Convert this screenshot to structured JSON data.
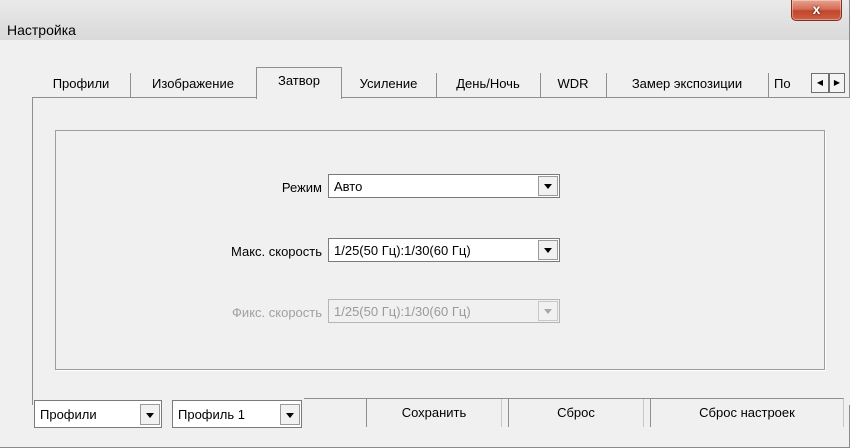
{
  "window": {
    "title": "Настройка",
    "close_label": "x"
  },
  "tabs": [
    {
      "label": "Профили",
      "active": false
    },
    {
      "label": "Изображение",
      "active": false
    },
    {
      "label": "Затвор",
      "active": true
    },
    {
      "label": "Усиление",
      "active": false
    },
    {
      "label": "День/Ночь",
      "active": false
    },
    {
      "label": "WDR",
      "active": false
    },
    {
      "label": "Замер экспозиции",
      "active": false
    },
    {
      "label": "По",
      "active": false
    }
  ],
  "tab_scroll": {
    "left_icon": "◀",
    "right_icon": "▶"
  },
  "shutter": {
    "mode_label": "Режим",
    "mode_value": "Авто",
    "max_speed_label": "Макс. скорость",
    "max_speed_value": "1/25(50 Гц):1/30(60 Гц)",
    "fixed_speed_label": "Фикс. скорость",
    "fixed_speed_value": "1/25(50 Гц):1/30(60 Гц)"
  },
  "bottom": {
    "profiles_select": "Профили",
    "profile_select": "Профиль 1",
    "save_label": "Сохранить",
    "reset_label": "Сброс",
    "reset_settings_label": "Сброс настроек"
  }
}
